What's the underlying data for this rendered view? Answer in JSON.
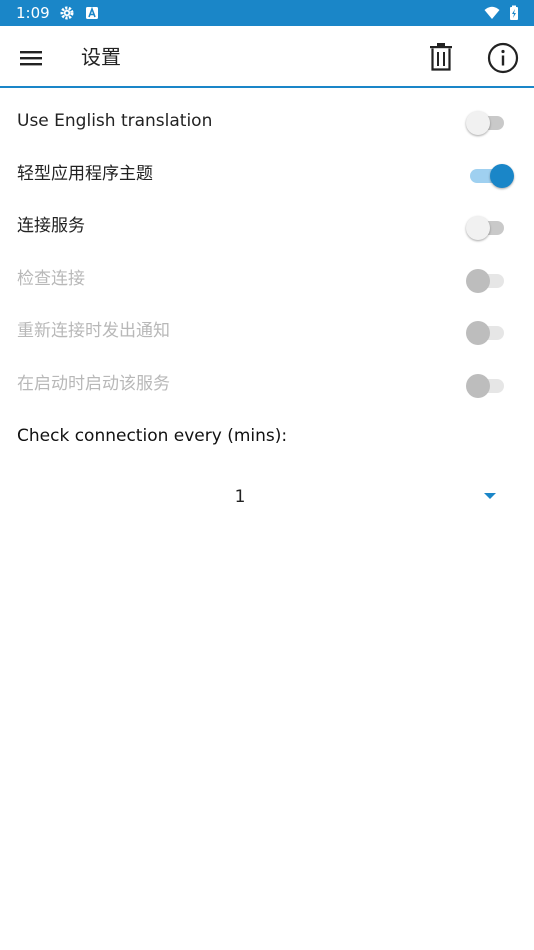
{
  "status_bar": {
    "time": "1:09",
    "icons": [
      "settings-gear-icon",
      "a-badge-icon",
      "wifi-icon",
      "battery-charging-icon"
    ]
  },
  "app_bar": {
    "title": "设置",
    "menu_icon": "hamburger-menu-icon",
    "delete_icon": "trash-icon",
    "info_icon": "info-icon"
  },
  "settings": [
    {
      "label": "Use English translation",
      "state": "off",
      "enabled": true
    },
    {
      "label": "轻型应用程序主题",
      "state": "on",
      "enabled": true
    },
    {
      "label": "连接服务",
      "state": "off",
      "enabled": true
    },
    {
      "label": "检查连接",
      "state": "off",
      "enabled": false
    },
    {
      "label": "重新连接时发出通知",
      "state": "off",
      "enabled": false
    },
    {
      "label": "在启动时启动该服务",
      "state": "off",
      "enabled": false
    }
  ],
  "interval": {
    "label": "Check connection every (mins):",
    "selected_value": "1"
  },
  "colors": {
    "accent": "#1a86c8",
    "disabled_text": "#b8b8b8"
  }
}
